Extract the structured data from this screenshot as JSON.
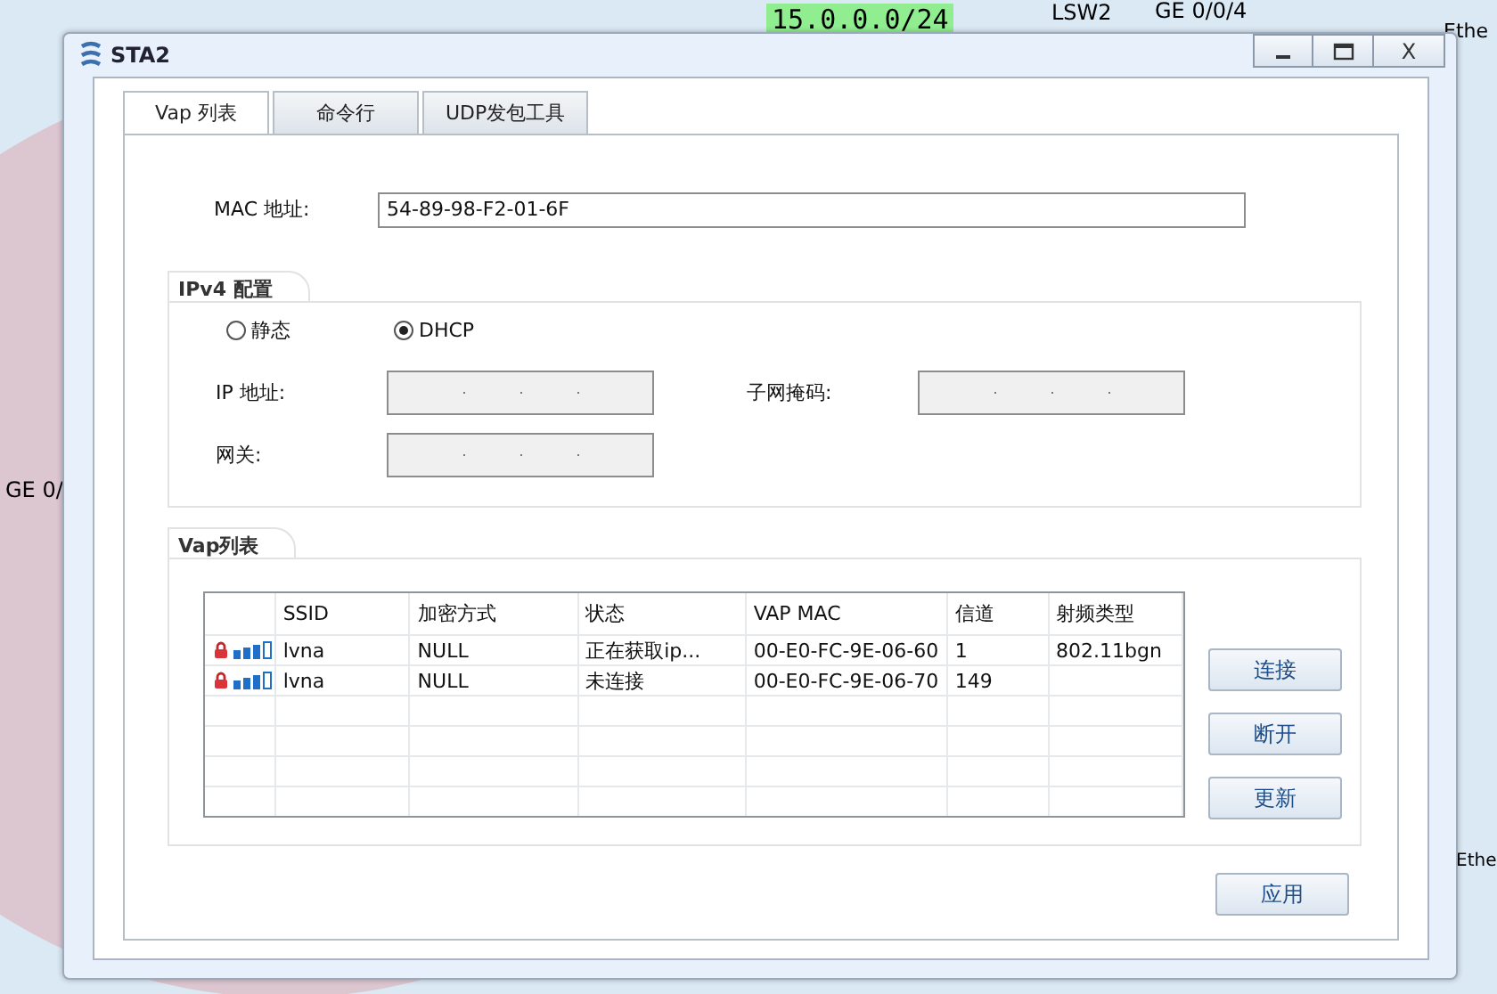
{
  "canvas": {
    "labels": [
      "15.0.0.0/24",
      "LSW2",
      "GE 0/0/4",
      "Ethe",
      "GE 0/",
      "Ethe"
    ]
  },
  "window": {
    "title": "STA2",
    "close_label": "X"
  },
  "tabs": [
    {
      "label": "Vap 列表",
      "selected": true
    },
    {
      "label": "命令行",
      "selected": false
    },
    {
      "label": "UDP发包工具",
      "selected": false
    }
  ],
  "mac": {
    "label": "MAC 地址:",
    "value": "54-89-98-F2-01-6F"
  },
  "ipv4": {
    "title": "IPv4 配置",
    "modes": [
      {
        "label": "静态",
        "selected": false
      },
      {
        "label": "DHCP",
        "selected": true
      }
    ],
    "ip_label": "IP 地址:",
    "mask_label": "子网掩码:",
    "gateway_label": "网关:"
  },
  "vap": {
    "title": "Vap列表",
    "columns": [
      "SSID",
      "加密方式",
      "状态",
      "VAP MAC",
      "信道",
      "射频类型"
    ],
    "rows": [
      {
        "locked": true,
        "cells": [
          "lvna",
          "NULL",
          "正在获取ip...",
          "00-E0-FC-9E-06-60",
          "1",
          "802.11bgn"
        ]
      },
      {
        "locked": true,
        "cells": [
          "lvna",
          "NULL",
          "未连接",
          "00-E0-FC-9E-06-70",
          "149",
          ""
        ]
      }
    ],
    "buttons": [
      "连接",
      "断开",
      "更新"
    ]
  },
  "apply": "应用"
}
